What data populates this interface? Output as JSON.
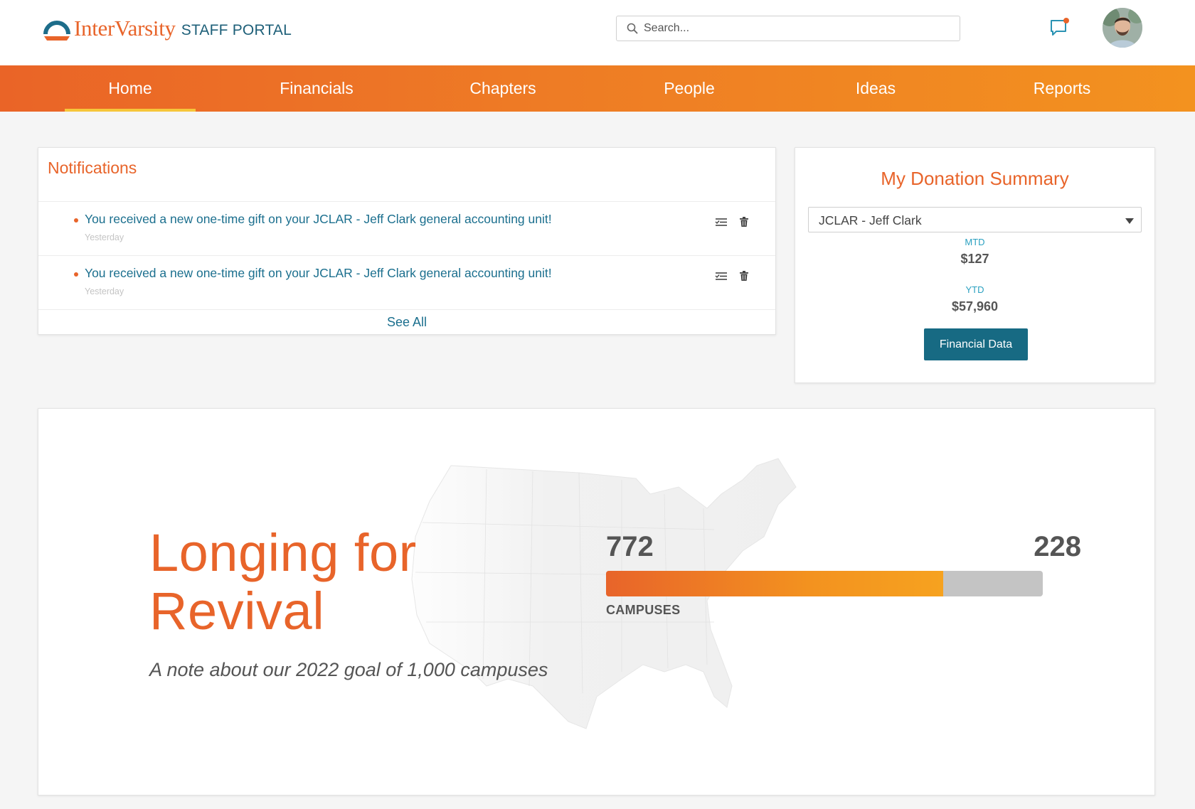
{
  "brand": {
    "name": "InterVarsity",
    "portal": "STAFF PORTAL",
    "colors": {
      "orange": "#e8642a",
      "teal": "#1d5f78",
      "link": "#1b6f8e",
      "button": "#176a83"
    }
  },
  "header": {
    "search_placeholder": "Search...",
    "icons": {
      "search": "search-icon",
      "messages": "message-notification-icon",
      "avatar": "user-avatar"
    }
  },
  "nav": {
    "items": [
      {
        "label": "Home",
        "active": true
      },
      {
        "label": "Financials",
        "active": false
      },
      {
        "label": "Chapters",
        "active": false
      },
      {
        "label": "People",
        "active": false
      },
      {
        "label": "Ideas",
        "active": false
      },
      {
        "label": "Reports",
        "active": false
      }
    ]
  },
  "notifications": {
    "title": "Notifications",
    "items": [
      {
        "text": "You received a new one-time gift on your JCLAR - Jeff Clark general accounting unit!",
        "time": "Yesterday"
      },
      {
        "text": "You received a new one-time gift on your JCLAR - Jeff Clark general accounting unit!",
        "time": "Yesterday"
      }
    ],
    "see_all": "See All",
    "row_icons": [
      "mark-read-icon",
      "trash-icon"
    ]
  },
  "donation_summary": {
    "title": "My Donation Summary",
    "selected_account": "JCLAR - Jeff Clark",
    "mtd_label": "MTD",
    "mtd_value": "$127",
    "ytd_label": "YTD",
    "ytd_value": "$57,960",
    "button_label": "Financial Data"
  },
  "hero": {
    "title_line1": "Longing for",
    "title_line2": "Revival",
    "subtitle": "A note about our 2022 goal of 1,000 campuses",
    "reached": "772",
    "remaining": "228",
    "progress_fraction": 0.772,
    "bar_label": "CAMPUSES"
  }
}
